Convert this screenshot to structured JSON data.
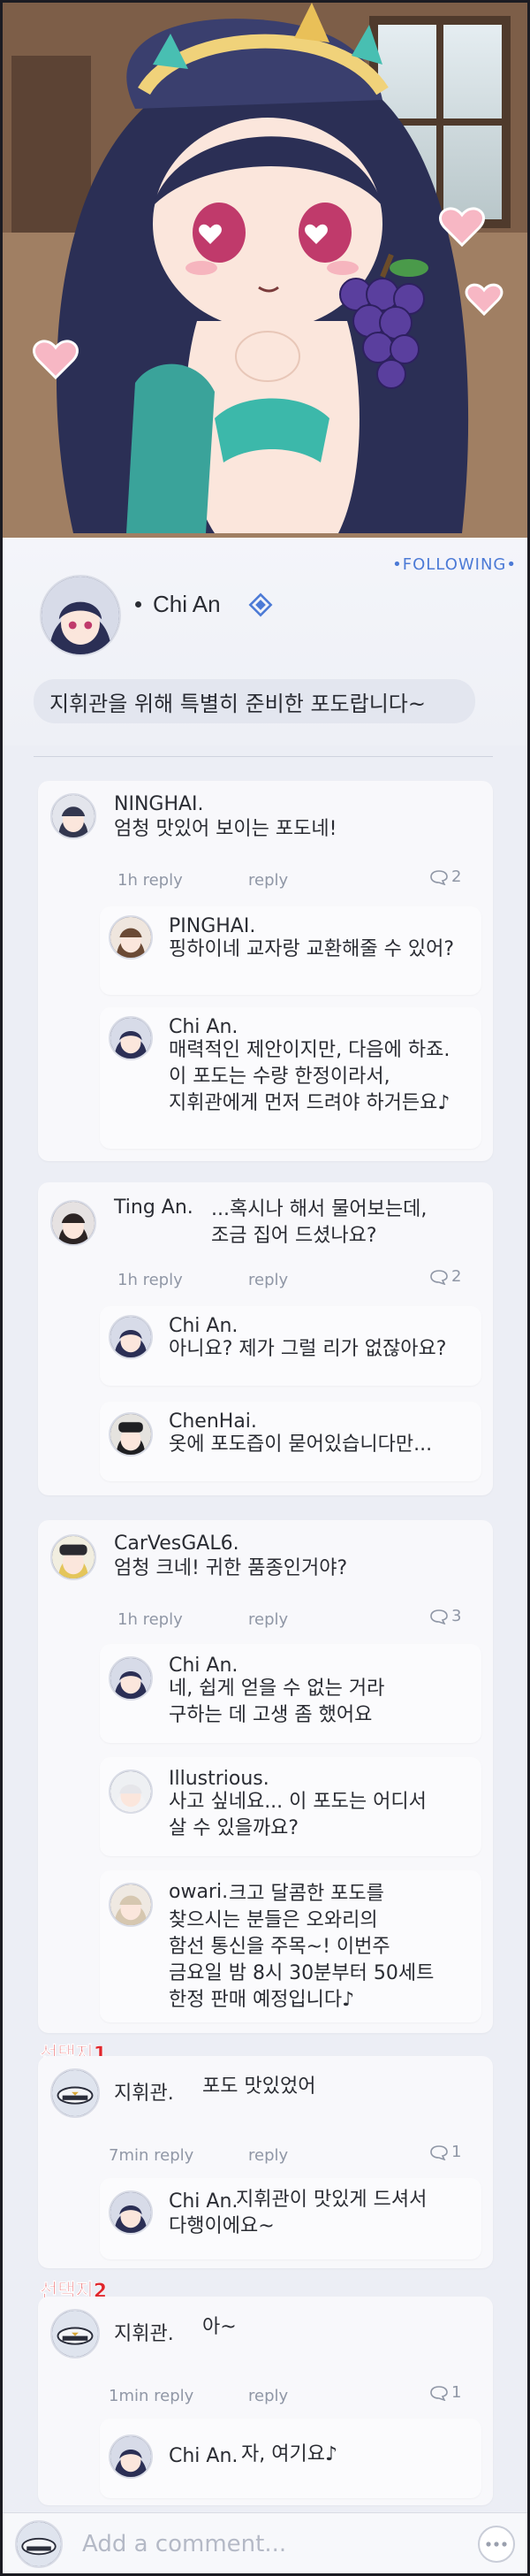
{
  "post": {
    "following": "•FOLLOWING•",
    "author": "Chi An",
    "text": "지휘관을 위해 특별히 준비한 포도랍니다~"
  },
  "comments": [
    {
      "name": "NINGHAI.",
      "text": "엄청 맛있어 보이는 포도네!",
      "time": "1h reply",
      "reply": "reply",
      "count": "2",
      "replies": [
        {
          "name": "PINGHAI.",
          "text": "핑하이네 교자랑 교환해줄 수 있어?"
        },
        {
          "name": "Chi An.",
          "text": "매력적인 제안이지만, 다음에 하죠.\n이 포도는 수량 한정이라서,\n지휘관에게 먼저 드려야 하거든요♪"
        }
      ]
    },
    {
      "name": "Ting An.",
      "text": "...혹시나 해서 물어보는데,\n조금 집어 드셨나요?",
      "time": "1h reply",
      "reply": "reply",
      "count": "2",
      "replies": [
        {
          "name": "Chi An.",
          "text": "아니요? 제가 그럴 리가 없잖아요?"
        },
        {
          "name": "ChenHai.",
          "text": "옷에 포도즙이 묻어있습니다만..."
        }
      ]
    },
    {
      "name": "CarVesGAL6.",
      "text": "엄청 크네! 귀한 품종인거야?",
      "time": "1h reply",
      "reply": "reply",
      "count": "3",
      "replies": [
        {
          "name": "Chi An.",
          "text": "네, 쉽게 얻을 수 없는 거라\n구하는 데 고생 좀 했어요"
        },
        {
          "name": "Illustrious.",
          "text": "사고 싶네요... 이 포도는 어디서\n살 수 있을까요?"
        },
        {
          "name": "owari.",
          "text": "크고 달콤한 포도를\n찾으시는 분들은 오와리의\n함선 통신을 주목~! 이번주\n금요일 밤 8시 30분부터 50세트\n한정 판매 예정입니다♪"
        }
      ]
    }
  ],
  "choices": [
    {
      "label": "선택지1",
      "name": "지휘관.",
      "text": "포도 맛있었어",
      "time": "7min reply",
      "reply": "reply",
      "count": "1",
      "reply_item": {
        "name": "Chi An.",
        "text": "지휘관이 맛있게 드셔서\n다행이에요~"
      }
    },
    {
      "label": "선택지2",
      "name": "지휘관.",
      "text": "아~",
      "time": "1min reply",
      "reply": "reply",
      "count": "1",
      "reply_item": {
        "name": "Chi An.",
        "text": "자, 여기요♪"
      }
    }
  ],
  "input": {
    "placeholder": "Add a comment..."
  },
  "colors": {
    "accent": "#4c7ad6",
    "choice": "#e0262c",
    "meta": "#9097a6"
  }
}
